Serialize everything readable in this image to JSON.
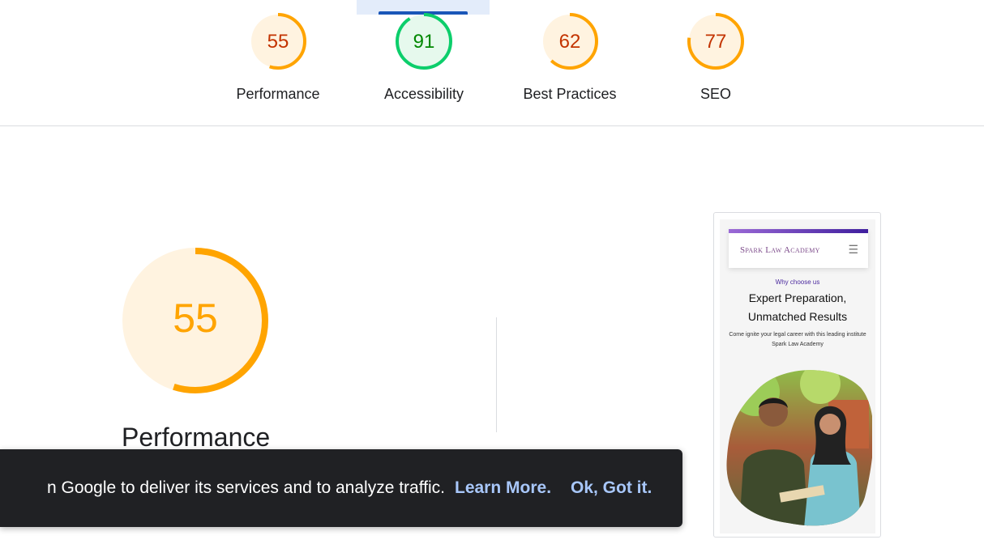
{
  "scores": [
    {
      "label": "Performance",
      "value": "55",
      "fraction": 0.55,
      "status": "average"
    },
    {
      "label": "Accessibility",
      "value": "91",
      "fraction": 0.91,
      "status": "pass"
    },
    {
      "label": "Best Practices",
      "value": "62",
      "fraction": 0.62,
      "status": "average"
    },
    {
      "label": "SEO",
      "value": "77",
      "fraction": 0.77,
      "status": "average"
    }
  ],
  "colors": {
    "average": "#ffa400",
    "average_text": "#c33300",
    "average_bg": "#fff3e0",
    "pass": "#0cce6b",
    "pass_text": "#008800",
    "pass_bg": "#e6f9ed",
    "tab_indicator": "#1a56b8"
  },
  "main_category": {
    "title": "Performance",
    "score": "55",
    "fraction": 0.55
  },
  "screenshot": {
    "brand": "Spark Law Academy",
    "menu_icon": "hamburger-menu-icon",
    "eyebrow": "Why choose us",
    "headline_line1": "Expert Preparation,",
    "headline_line2": "Unmatched Results",
    "body_line1": "Come ignite your legal career with this leading institute",
    "body_line2": "Spark Law Academy"
  },
  "toast": {
    "message": "n Google to deliver its services and to analyze traffic.",
    "learn_more": "Learn More.",
    "ok": "Ok, Got it."
  }
}
